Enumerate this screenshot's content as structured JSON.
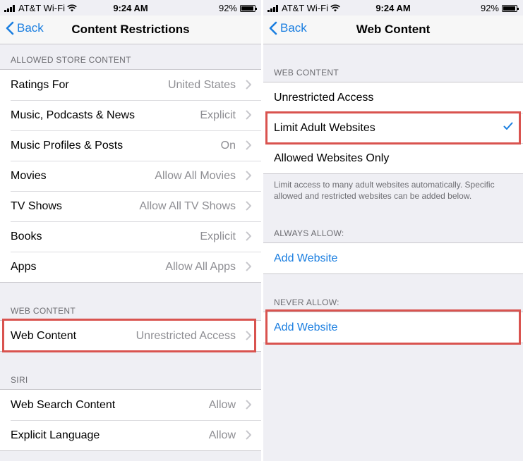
{
  "left": {
    "status": {
      "carrier": "AT&T Wi-Fi",
      "time": "9:24 AM",
      "battery": "92%"
    },
    "nav": {
      "back": "Back",
      "title": "Content Restrictions"
    },
    "store": {
      "header": "ALLOWED STORE CONTENT",
      "rows": [
        {
          "label": "Ratings For",
          "value": "United States"
        },
        {
          "label": "Music, Podcasts & News",
          "value": "Explicit"
        },
        {
          "label": "Music Profiles & Posts",
          "value": "On"
        },
        {
          "label": "Movies",
          "value": "Allow All Movies"
        },
        {
          "label": "TV Shows",
          "value": "Allow All TV Shows"
        },
        {
          "label": "Books",
          "value": "Explicit"
        },
        {
          "label": "Apps",
          "value": "Allow All Apps"
        }
      ]
    },
    "web": {
      "header": "WEB CONTENT",
      "row": {
        "label": "Web Content",
        "value": "Unrestricted Access"
      }
    },
    "siri": {
      "header": "SIRI",
      "rows": [
        {
          "label": "Web Search Content",
          "value": "Allow"
        },
        {
          "label": "Explicit Language",
          "value": "Allow"
        }
      ]
    }
  },
  "right": {
    "status": {
      "carrier": "AT&T Wi-Fi",
      "time": "9:24 AM",
      "battery": "92%"
    },
    "nav": {
      "back": "Back",
      "title": "Web Content"
    },
    "web": {
      "header": "WEB CONTENT",
      "options": [
        {
          "label": "Unrestricted Access",
          "selected": false
        },
        {
          "label": "Limit Adult Websites",
          "selected": true
        },
        {
          "label": "Allowed Websites Only",
          "selected": false
        }
      ],
      "note": "Limit access to many adult websites automatically. Specific allowed and restricted websites can be added below."
    },
    "always_allow": {
      "header": "ALWAYS ALLOW:",
      "add": "Add Website"
    },
    "never_allow": {
      "header": "NEVER ALLOW:",
      "add": "Add Website"
    }
  },
  "colors": {
    "accent": "#1a7ee0",
    "highlight": "#d9534f",
    "background": "#efeff4"
  },
  "icons": [
    "wifi-icon",
    "battery-icon",
    "chevron-left-icon",
    "chevron-right-icon",
    "checkmark-icon"
  ]
}
